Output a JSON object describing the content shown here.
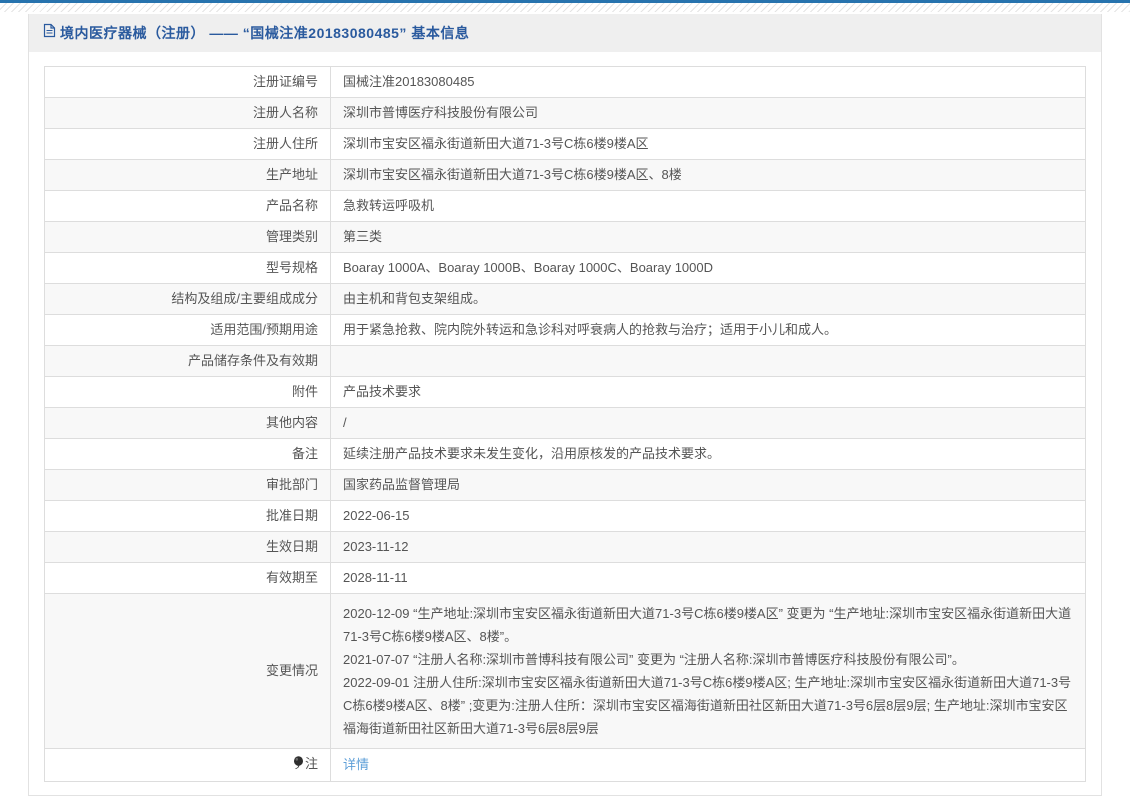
{
  "page": {
    "top_bar_color": "#2773ae",
    "accent_blue": "#2a5a9e",
    "link_blue": "#5e9fd8"
  },
  "header": {
    "icon": "document-icon",
    "title": "境内医疗器械（注册） —— “国械注准20183080485” 基本信息"
  },
  "table": {
    "rows": [
      {
        "label": "注册证编号",
        "value": "国械注准20183080485"
      },
      {
        "label": "注册人名称",
        "value": "深圳市普博医疗科技股份有限公司"
      },
      {
        "label": "注册人住所",
        "value": "深圳市宝安区福永街道新田大道71-3号C栋6楼9楼A区"
      },
      {
        "label": "生产地址",
        "value": "深圳市宝安区福永街道新田大道71-3号C栋6楼9楼A区、8楼"
      },
      {
        "label": "产品名称",
        "value": "急救转运呼吸机"
      },
      {
        "label": "管理类别",
        "value": "第三类"
      },
      {
        "label": "型号规格",
        "value": "Boaray 1000A、Boaray 1000B、Boaray 1000C、Boaray 1000D"
      },
      {
        "label": "结构及组成/主要组成成分",
        "value": "由主机和背包支架组成。"
      },
      {
        "label": "适用范围/预期用途",
        "value": "用于紧急抢救、院内院外转运和急诊科对呼衰病人的抢救与治疗；适用于小儿和成人。"
      },
      {
        "label": "产品储存条件及有效期",
        "value": ""
      },
      {
        "label": "附件",
        "value": "产品技术要求"
      },
      {
        "label": "其他内容",
        "value": "/"
      },
      {
        "label": "备注",
        "value": "延续注册产品技术要求未发生变化，沿用原核发的产品技术要求。"
      },
      {
        "label": "审批部门",
        "value": "国家药品监督管理局"
      },
      {
        "label": "批准日期",
        "value": "2022-06-15"
      },
      {
        "label": "生效日期",
        "value": "2023-11-12"
      },
      {
        "label": "有效期至",
        "value": "2028-11-11"
      },
      {
        "label": "变更情况",
        "value": "2020-12-09 “生产地址:深圳市宝安区福永街道新田大道71-3号C栋6楼9楼A区” 变更为 “生产地址:深圳市宝安区福永街道新田大道71-3号C栋6楼9楼A区、8楼”。\n2021-07-07 “注册人名称:深圳市普博科技有限公司” 变更为 “注册人名称:深圳市普博医疗科技股份有限公司”。\n2022-09-01 注册人住所:深圳市宝安区福永街道新田大道71-3号C栋6楼9楼A区; 生产地址:深圳市宝安区福永街道新田大道71-3号C栋6楼9楼A区、8楼” ;变更为:注册人住所：深圳市宝安区福海街道新田社区新田大道71-3号6层8层9层; 生产地址:深圳市宝安区福海街道新田社区新田大道71-3号6层8层9层"
      },
      {
        "label": "注",
        "value": "详情"
      }
    ]
  }
}
